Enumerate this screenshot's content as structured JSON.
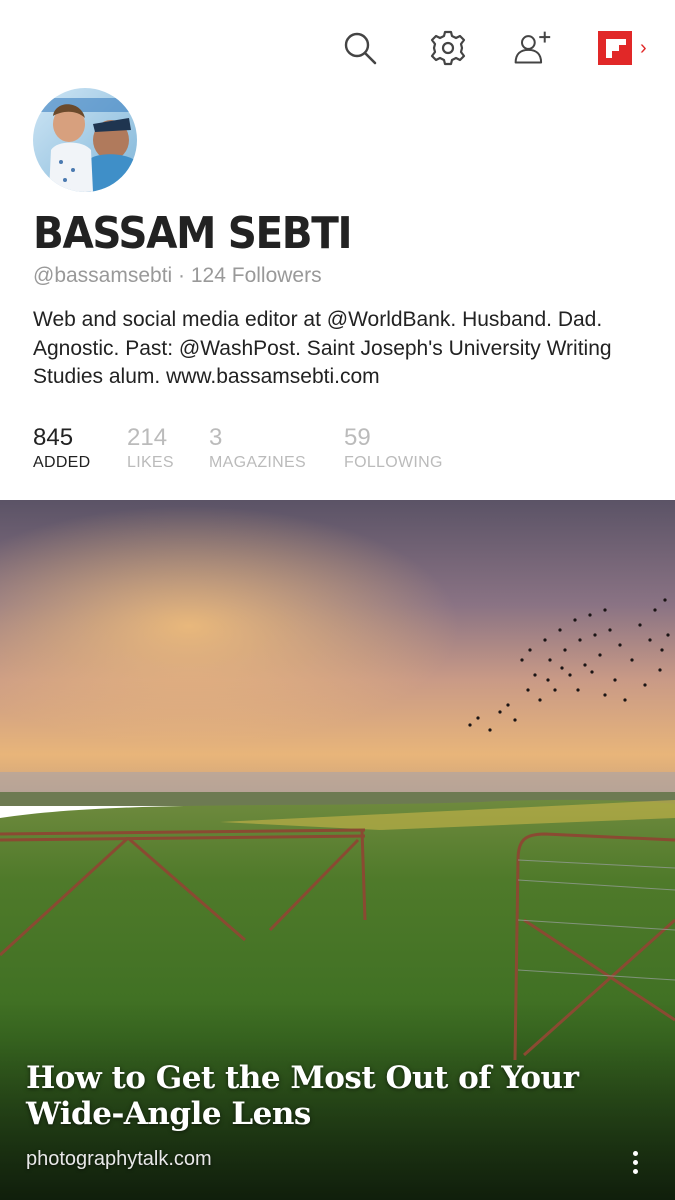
{
  "toolbar": {
    "icons": [
      "search-icon",
      "gear-icon",
      "add-user-icon",
      "flipboard-logo-icon",
      "chevron-right-icon"
    ],
    "accent_color": "#e12828"
  },
  "profile": {
    "name": "BASSAM SEBTI",
    "handle_line": "@bassamsebti · 124 Followers",
    "bio": "Web and social media editor at @WorldBank. Husband. Dad. Agnostic. Past: @WashPost. Saint Joseph's University Writing Studies alum. www.bassamsebti.com"
  },
  "stats": [
    {
      "value": "845",
      "label": "ADDED",
      "active": true
    },
    {
      "value": "214",
      "label": "LIKES",
      "active": false
    },
    {
      "value": "3",
      "label": "MAGAZINES",
      "active": false
    },
    {
      "value": "59",
      "label": "FOLLOWING",
      "active": false
    }
  ],
  "article": {
    "title": "How to Get the Most Out of Your Wide-Angle Lens",
    "source": "photographytalk.com",
    "menu_icon": "more-vertical-icon"
  }
}
